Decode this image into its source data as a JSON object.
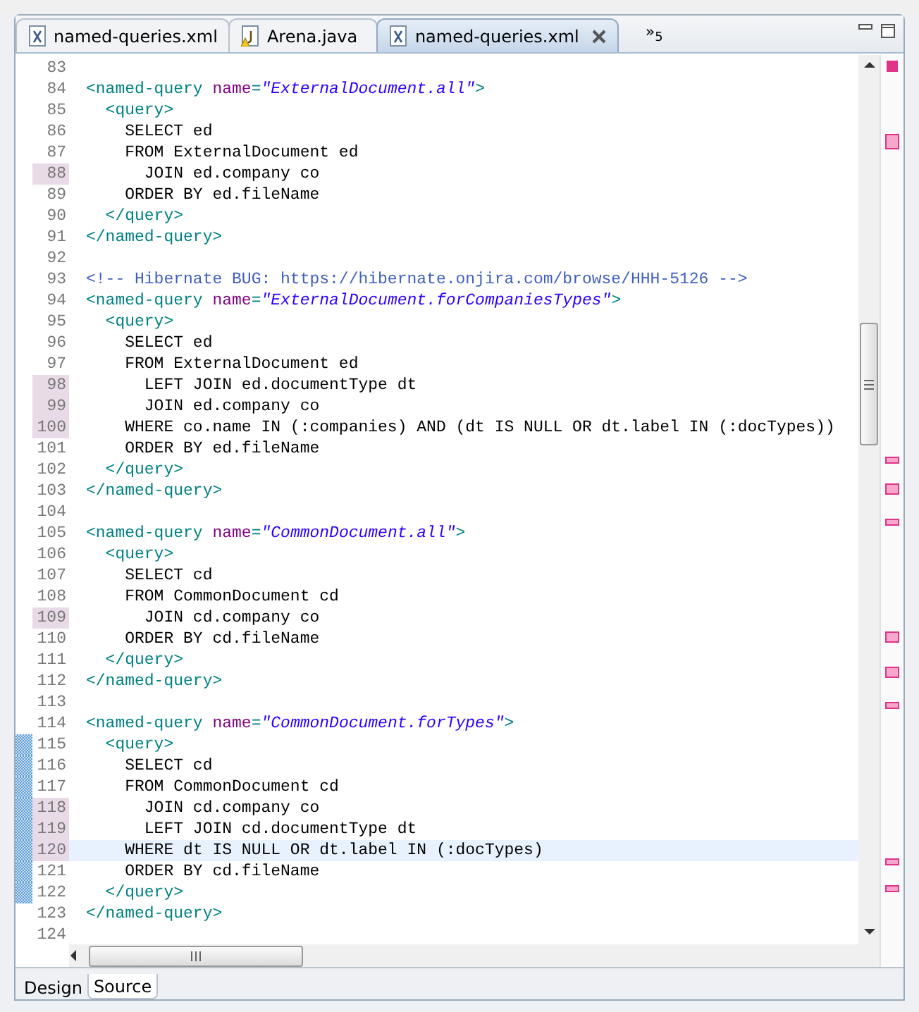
{
  "tabs": [
    {
      "label": "named-queries.xml",
      "kind": "xml",
      "warning": false,
      "selected": false
    },
    {
      "label": "Arena.java",
      "kind": "java",
      "warning": true,
      "selected": false
    },
    {
      "label": "named-queries.xml",
      "kind": "xml",
      "warning": false,
      "selected": true
    }
  ],
  "overflow": {
    "symbol": "»",
    "count": "5"
  },
  "editor": {
    "lines": [
      {
        "number": "83",
        "changed": false,
        "added": false,
        "current": false
      },
      {
        "number": "84",
        "changed": false,
        "added": false,
        "current": false,
        "segments": [
          {
            "kind": "tag",
            "text": "<named-query "
          },
          {
            "kind": "attr",
            "text": "name"
          },
          {
            "kind": "tag",
            "text": "="
          },
          {
            "kind": "value",
            "text": "\"ExternalDocument.all\""
          },
          {
            "kind": "tag",
            "text": ">"
          }
        ]
      },
      {
        "number": "85",
        "changed": false,
        "added": false,
        "current": false,
        "segments": [
          {
            "kind": "tag",
            "text": "  <query>"
          }
        ]
      },
      {
        "number": "86",
        "changed": false,
        "added": false,
        "current": false,
        "segments": [
          {
            "kind": "text",
            "text": "    SELECT ed"
          }
        ]
      },
      {
        "number": "87",
        "changed": false,
        "added": false,
        "current": false,
        "segments": [
          {
            "kind": "text",
            "text": "    FROM ExternalDocument ed"
          }
        ]
      },
      {
        "number": "88",
        "changed": true,
        "added": false,
        "current": false,
        "segments": [
          {
            "kind": "text",
            "text": "      JOIN ed.company co"
          }
        ]
      },
      {
        "number": "89",
        "changed": false,
        "added": false,
        "current": false,
        "segments": [
          {
            "kind": "text",
            "text": "    ORDER BY ed.fileName"
          }
        ]
      },
      {
        "number": "90",
        "changed": false,
        "added": false,
        "current": false,
        "segments": [
          {
            "kind": "tag",
            "text": "  </query>"
          }
        ]
      },
      {
        "number": "91",
        "changed": false,
        "added": false,
        "current": false,
        "segments": [
          {
            "kind": "tag",
            "text": "</named-query>"
          }
        ]
      },
      {
        "number": "92",
        "changed": false,
        "added": false,
        "current": false
      },
      {
        "number": "93",
        "changed": false,
        "added": false,
        "current": false,
        "segments": [
          {
            "kind": "comment",
            "text": "<!-- Hibernate BUG: https://hibernate.onjira.com/browse/HHH-5126 -->"
          }
        ]
      },
      {
        "number": "94",
        "changed": false,
        "added": false,
        "current": false,
        "segments": [
          {
            "kind": "tag",
            "text": "<named-query "
          },
          {
            "kind": "attr",
            "text": "name"
          },
          {
            "kind": "tag",
            "text": "="
          },
          {
            "kind": "value",
            "text": "\"ExternalDocument.forCompaniesTypes\""
          },
          {
            "kind": "tag",
            "text": ">"
          }
        ]
      },
      {
        "number": "95",
        "changed": false,
        "added": false,
        "current": false,
        "segments": [
          {
            "kind": "tag",
            "text": "  <query>"
          }
        ]
      },
      {
        "number": "96",
        "changed": false,
        "added": false,
        "current": false,
        "segments": [
          {
            "kind": "text",
            "text": "    SELECT ed"
          }
        ]
      },
      {
        "number": "97",
        "changed": false,
        "added": false,
        "current": false,
        "segments": [
          {
            "kind": "text",
            "text": "    FROM ExternalDocument ed"
          }
        ]
      },
      {
        "number": "98",
        "changed": true,
        "added": false,
        "current": false,
        "segments": [
          {
            "kind": "text",
            "text": "      LEFT JOIN ed.documentType dt"
          }
        ]
      },
      {
        "number": "99",
        "changed": true,
        "added": false,
        "current": false,
        "segments": [
          {
            "kind": "text",
            "text": "      JOIN ed.company co"
          }
        ]
      },
      {
        "number": "100",
        "changed": true,
        "added": false,
        "current": false,
        "segments": [
          {
            "kind": "text",
            "text": "    WHERE co.name IN (:companies) AND (dt IS NULL OR dt.label IN (:docTypes))"
          }
        ]
      },
      {
        "number": "101",
        "changed": false,
        "added": false,
        "current": false,
        "segments": [
          {
            "kind": "text",
            "text": "    ORDER BY ed.fileName"
          }
        ]
      },
      {
        "number": "102",
        "changed": false,
        "added": false,
        "current": false,
        "segments": [
          {
            "kind": "tag",
            "text": "  </query>"
          }
        ]
      },
      {
        "number": "103",
        "changed": false,
        "added": false,
        "current": false,
        "segments": [
          {
            "kind": "tag",
            "text": "</named-query>"
          }
        ]
      },
      {
        "number": "104",
        "changed": false,
        "added": false,
        "current": false
      },
      {
        "number": "105",
        "changed": false,
        "added": false,
        "current": false,
        "segments": [
          {
            "kind": "tag",
            "text": "<named-query "
          },
          {
            "kind": "attr",
            "text": "name"
          },
          {
            "kind": "tag",
            "text": "="
          },
          {
            "kind": "value",
            "text": "\"CommonDocument.all\""
          },
          {
            "kind": "tag",
            "text": ">"
          }
        ]
      },
      {
        "number": "106",
        "changed": false,
        "added": false,
        "current": false,
        "segments": [
          {
            "kind": "tag",
            "text": "  <query>"
          }
        ]
      },
      {
        "number": "107",
        "changed": false,
        "added": false,
        "current": false,
        "segments": [
          {
            "kind": "text",
            "text": "    SELECT cd"
          }
        ]
      },
      {
        "number": "108",
        "changed": false,
        "added": false,
        "current": false,
        "segments": [
          {
            "kind": "text",
            "text": "    FROM CommonDocument cd"
          }
        ]
      },
      {
        "number": "109",
        "changed": true,
        "added": false,
        "current": false,
        "segments": [
          {
            "kind": "text",
            "text": "      JOIN cd.company co"
          }
        ]
      },
      {
        "number": "110",
        "changed": false,
        "added": false,
        "current": false,
        "segments": [
          {
            "kind": "text",
            "text": "    ORDER BY cd.fileName"
          }
        ]
      },
      {
        "number": "111",
        "changed": false,
        "added": false,
        "current": false,
        "segments": [
          {
            "kind": "tag",
            "text": "  </query>"
          }
        ]
      },
      {
        "number": "112",
        "changed": false,
        "added": false,
        "current": false,
        "segments": [
          {
            "kind": "tag",
            "text": "</named-query>"
          }
        ]
      },
      {
        "number": "113",
        "changed": false,
        "added": false,
        "current": false
      },
      {
        "number": "114",
        "changed": false,
        "added": false,
        "current": false,
        "segments": [
          {
            "kind": "tag",
            "text": "<named-query "
          },
          {
            "kind": "attr",
            "text": "name"
          },
          {
            "kind": "tag",
            "text": "="
          },
          {
            "kind": "value",
            "text": "\"CommonDocument.forTypes\""
          },
          {
            "kind": "tag",
            "text": ">"
          }
        ]
      },
      {
        "number": "115",
        "changed": false,
        "added": true,
        "current": false,
        "segments": [
          {
            "kind": "tag",
            "text": "  <query>"
          }
        ]
      },
      {
        "number": "116",
        "changed": false,
        "added": true,
        "current": false,
        "segments": [
          {
            "kind": "text",
            "text": "    SELECT cd"
          }
        ]
      },
      {
        "number": "117",
        "changed": false,
        "added": true,
        "current": false,
        "segments": [
          {
            "kind": "text",
            "text": "    FROM CommonDocument cd"
          }
        ]
      },
      {
        "number": "118",
        "changed": true,
        "added": true,
        "current": false,
        "segments": [
          {
            "kind": "text",
            "text": "      JOIN cd.company co"
          }
        ]
      },
      {
        "number": "119",
        "changed": true,
        "added": true,
        "current": false,
        "segments": [
          {
            "kind": "text",
            "text": "      LEFT JOIN cd.documentType dt"
          }
        ]
      },
      {
        "number": "120",
        "changed": true,
        "added": true,
        "current": true,
        "segments": [
          {
            "kind": "text",
            "text": "    WHERE dt IS NULL OR dt.label IN (:docTypes)"
          }
        ]
      },
      {
        "number": "121",
        "changed": false,
        "added": true,
        "current": false,
        "segments": [
          {
            "kind": "text",
            "text": "    ORDER BY cd.fileName"
          }
        ]
      },
      {
        "number": "122",
        "changed": false,
        "added": true,
        "current": false,
        "segments": [
          {
            "kind": "tag",
            "text": "  </query>"
          }
        ]
      },
      {
        "number": "123",
        "changed": false,
        "added": false,
        "current": false,
        "segments": [
          {
            "kind": "tag",
            "text": "</named-query>"
          }
        ]
      },
      {
        "number": "124",
        "changed": false,
        "added": false,
        "current": false
      }
    ]
  },
  "bottom_tabs": [
    {
      "label": "Design",
      "selected": false
    },
    {
      "label": "Source",
      "selected": true
    }
  ]
}
